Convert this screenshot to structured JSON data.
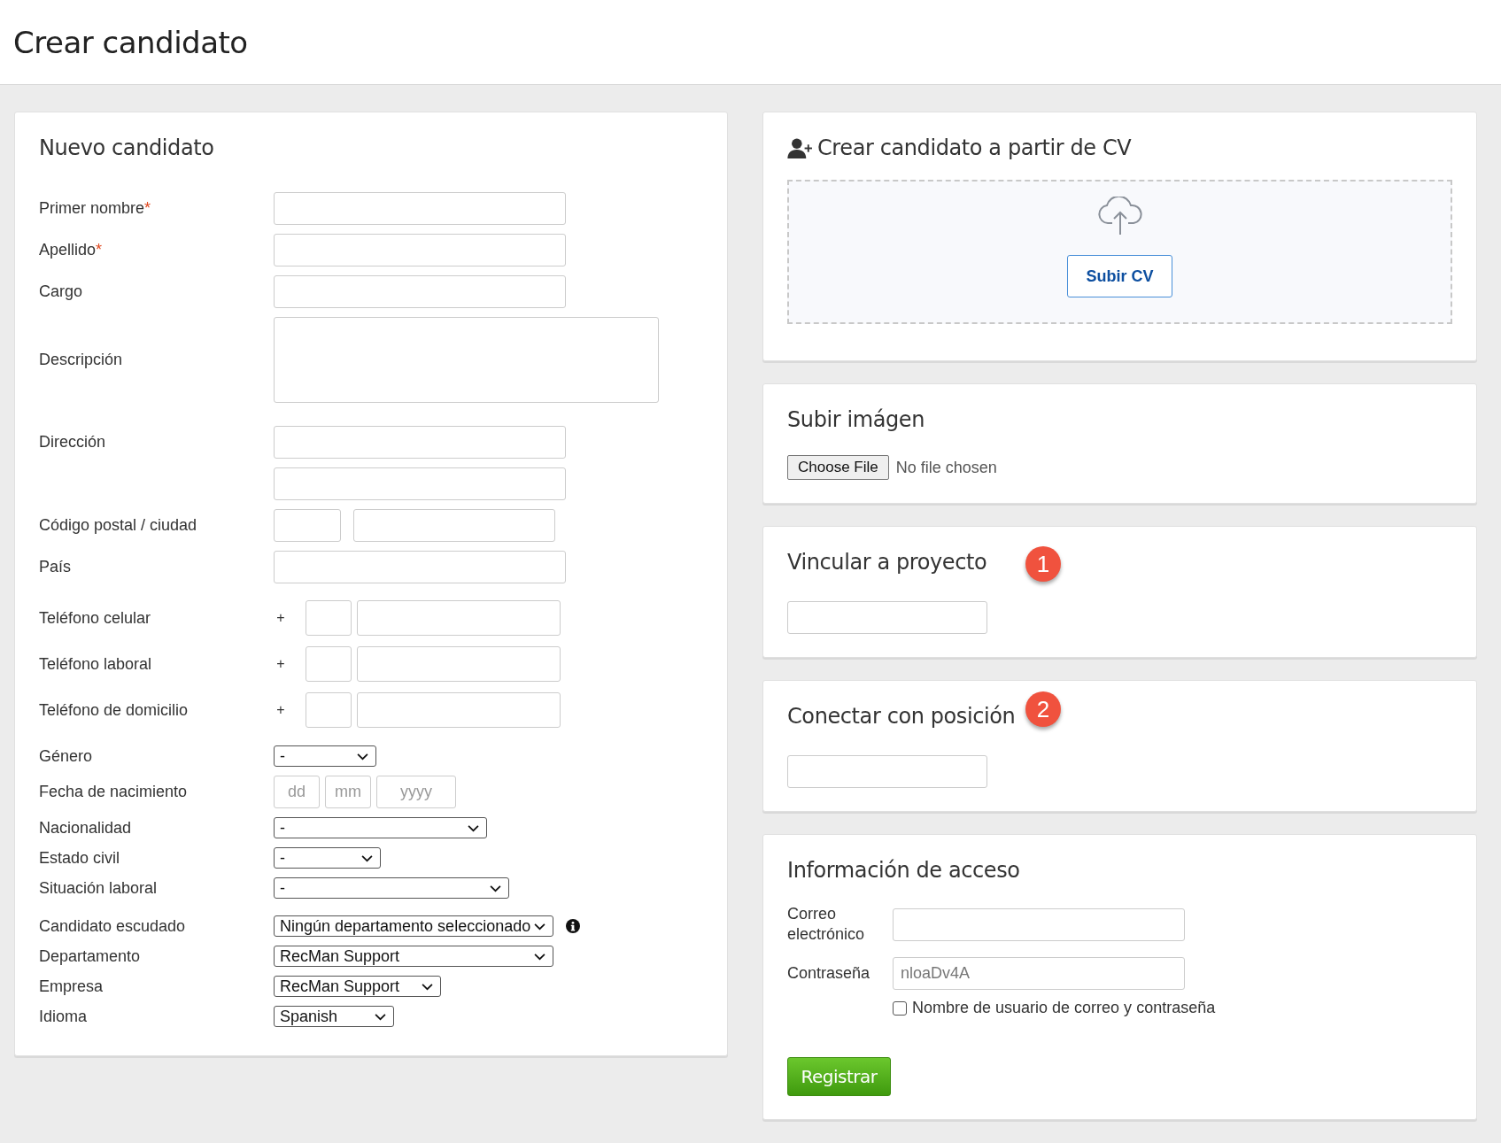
{
  "page": {
    "title": "Crear candidato"
  },
  "new_candidate": {
    "title": "Nuevo candidato",
    "required_mark": "*",
    "fields": [
      {
        "kind": "text",
        "label": "Primer nombre",
        "required": true
      },
      {
        "kind": "text",
        "label": "Apellido",
        "required": true
      },
      {
        "kind": "text",
        "label": "Cargo",
        "required": false
      },
      {
        "kind": "textarea",
        "label": "Descripción",
        "required": false
      },
      {
        "kind": "address",
        "label": "Dirección",
        "required": false
      },
      {
        "kind": "postal",
        "label": "Código postal / ciudad",
        "required": false
      },
      {
        "kind": "text",
        "label": "País",
        "required": false
      },
      {
        "kind": "phone",
        "label": "Teléfono celular",
        "required": false,
        "prefix": "+"
      },
      {
        "kind": "phone",
        "label": "Teléfono laboral",
        "required": false,
        "prefix": "+"
      },
      {
        "kind": "phone",
        "label": "Teléfono de domicilio",
        "required": false,
        "prefix": "+"
      },
      {
        "kind": "select",
        "label": "Género",
        "required": false,
        "value": "-"
      },
      {
        "kind": "date",
        "label": "Fecha de nacimiento",
        "required": false,
        "placeholders": [
          "dd",
          "mm",
          "yyyy"
        ]
      },
      {
        "kind": "select",
        "label": "Nacionalidad",
        "required": false,
        "value": "-"
      },
      {
        "kind": "select",
        "label": "Estado civil",
        "required": false,
        "value": "-"
      },
      {
        "kind": "select",
        "label": "Situación laboral",
        "required": false,
        "value": "-"
      },
      {
        "kind": "select",
        "label": "Candidato escudado",
        "required": false,
        "value": "Ningún departamento seleccionado",
        "info": true
      },
      {
        "kind": "select",
        "label": "Departamento",
        "required": false,
        "value": "RecMan Support"
      },
      {
        "kind": "select",
        "label": "Empresa",
        "required": false,
        "value": "RecMan Support"
      },
      {
        "kind": "select",
        "label": "Idioma",
        "required": false,
        "value": "Spanish"
      }
    ]
  },
  "cv_upload": {
    "title": "Crear candidato a partir de CV",
    "button": "Subir CV"
  },
  "image_upload": {
    "title": "Subir imágen",
    "button": "Choose File",
    "status": "No file chosen"
  },
  "link_project": {
    "title": "Vincular a proyecto",
    "callout": "1"
  },
  "connect_position": {
    "title": "Conectar con posición",
    "callout": "2"
  },
  "access_info": {
    "title": "Información de acceso",
    "email_label": "Correo electrónico",
    "password_label": "Contraseña",
    "password_value": "nloaDv4A",
    "checkbox": {
      "label": "Nombre de usuario de correo y contraseña",
      "checked": false
    },
    "submit": "Registrar"
  }
}
